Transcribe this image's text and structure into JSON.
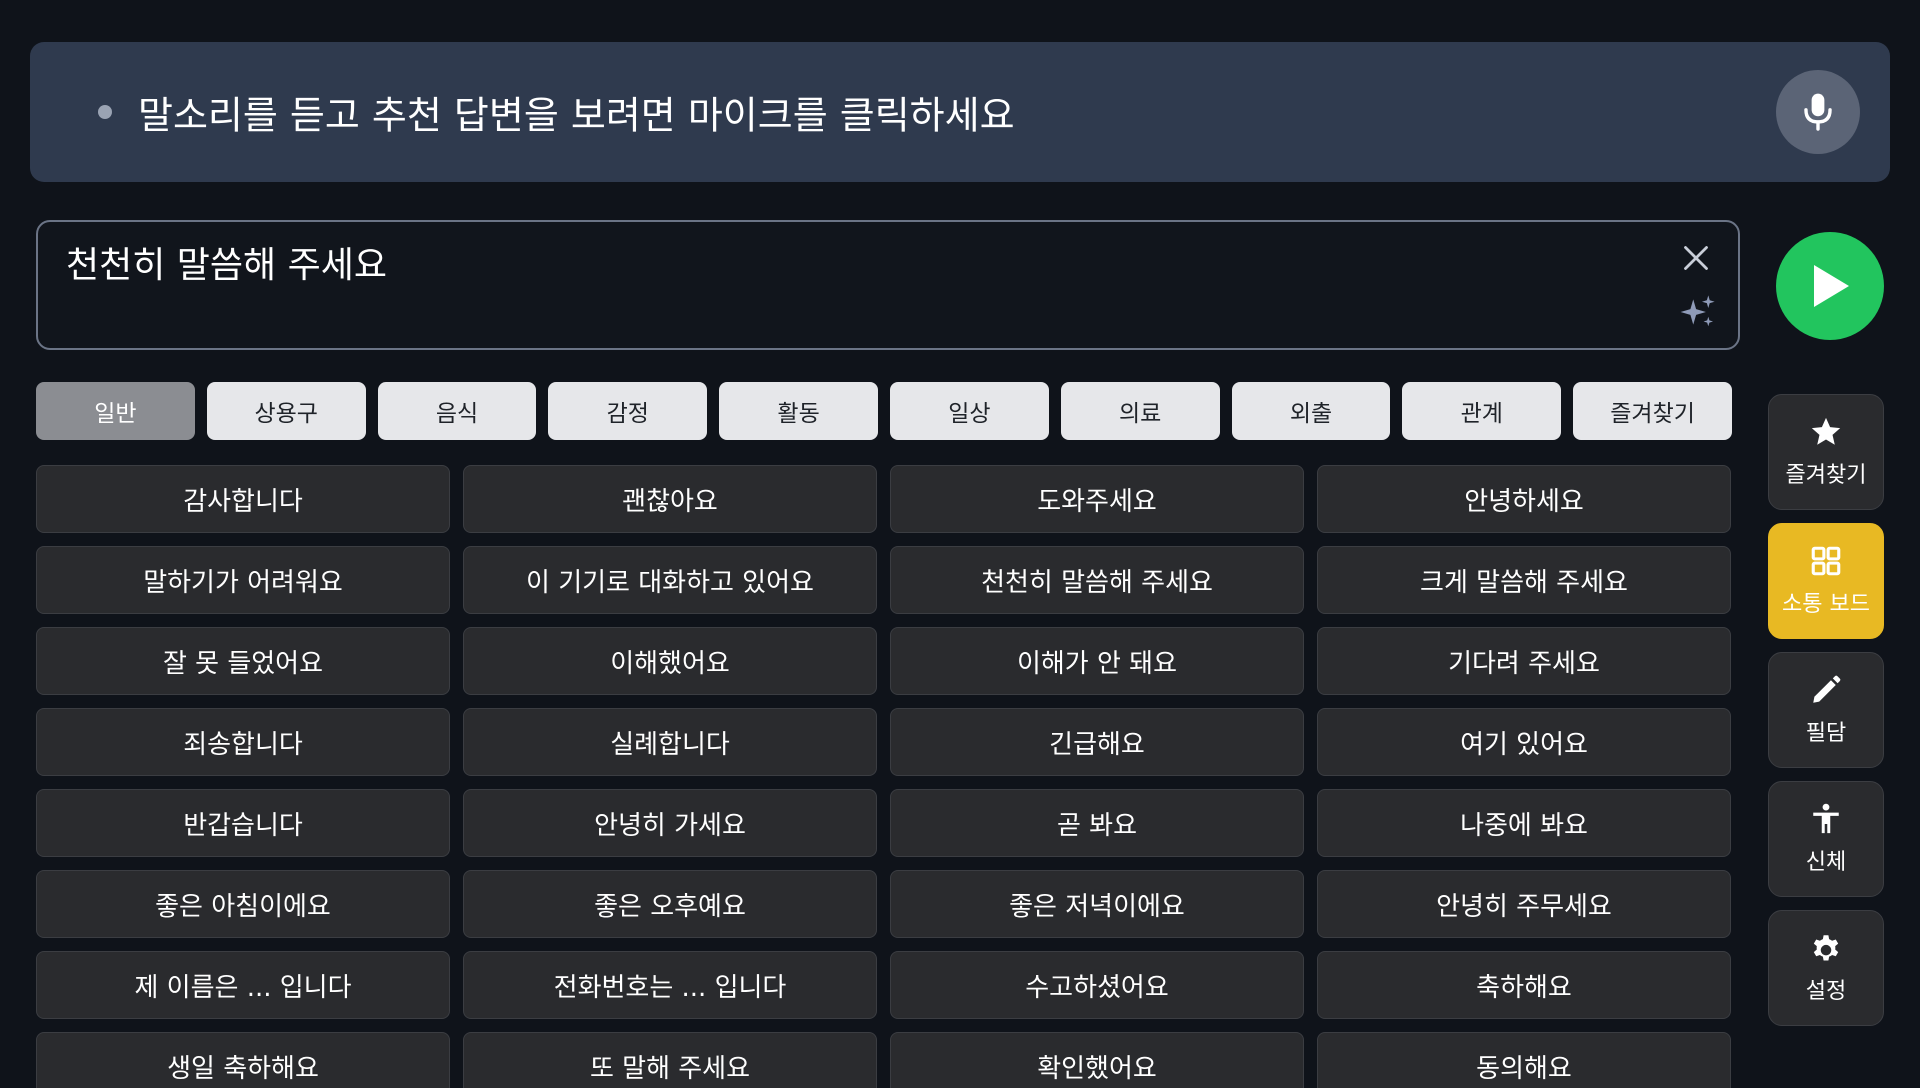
{
  "banner": {
    "prompt": "말소리를 듣고 추천 답변을 보려면 마이크를 클릭하세요",
    "mic_icon": "microphone-icon"
  },
  "input": {
    "text": "천천히 말씀해 주세요",
    "clear_icon": "close-icon",
    "suggest_icon": "sparkle-icon"
  },
  "play_icon": "play-icon",
  "tabs": [
    {
      "label": "일반",
      "active": true
    },
    {
      "label": "상용구"
    },
    {
      "label": "음식"
    },
    {
      "label": "감정"
    },
    {
      "label": "활동"
    },
    {
      "label": "일상"
    },
    {
      "label": "의료"
    },
    {
      "label": "외출"
    },
    {
      "label": "관계"
    },
    {
      "label": "즐겨찾기"
    }
  ],
  "phrases": [
    "감사합니다",
    "괜찮아요",
    "도와주세요",
    "안녕하세요",
    "말하기가 어려워요",
    "이 기기로 대화하고 있어요",
    "천천히 말씀해 주세요",
    "크게 말씀해 주세요",
    "잘 못 들었어요",
    "이해했어요",
    "이해가 안 돼요",
    "기다려 주세요",
    "죄송합니다",
    "실례합니다",
    "긴급해요",
    "여기 있어요",
    "반갑습니다",
    "안녕히 가세요",
    "곧 봐요",
    "나중에 봐요",
    "좋은 아침이에요",
    "좋은 오후예요",
    "좋은 저녁이에요",
    "안녕히 주무세요",
    "제 이름은 ... 입니다",
    "전화번호는 ... 입니다",
    "수고하셨어요",
    "축하해요",
    "생일 축하해요",
    "또 말해 주세요",
    "확인했어요",
    "동의해요"
  ],
  "side": {
    "favorites": {
      "label": "즐겨찾기",
      "icon": "star-icon"
    },
    "board": {
      "label": "소통 보드",
      "icon": "grid-icon",
      "active": true
    },
    "writing": {
      "label": "필담",
      "icon": "pencil-icon"
    },
    "body": {
      "label": "신체",
      "icon": "person-icon"
    },
    "settings": {
      "label": "설정",
      "icon": "gear-icon"
    }
  },
  "colors": {
    "banner_bg": "#2f3a4e",
    "play_green": "#22c55e",
    "active_side": "#e8b923",
    "active_tab": "#8b8d92"
  }
}
